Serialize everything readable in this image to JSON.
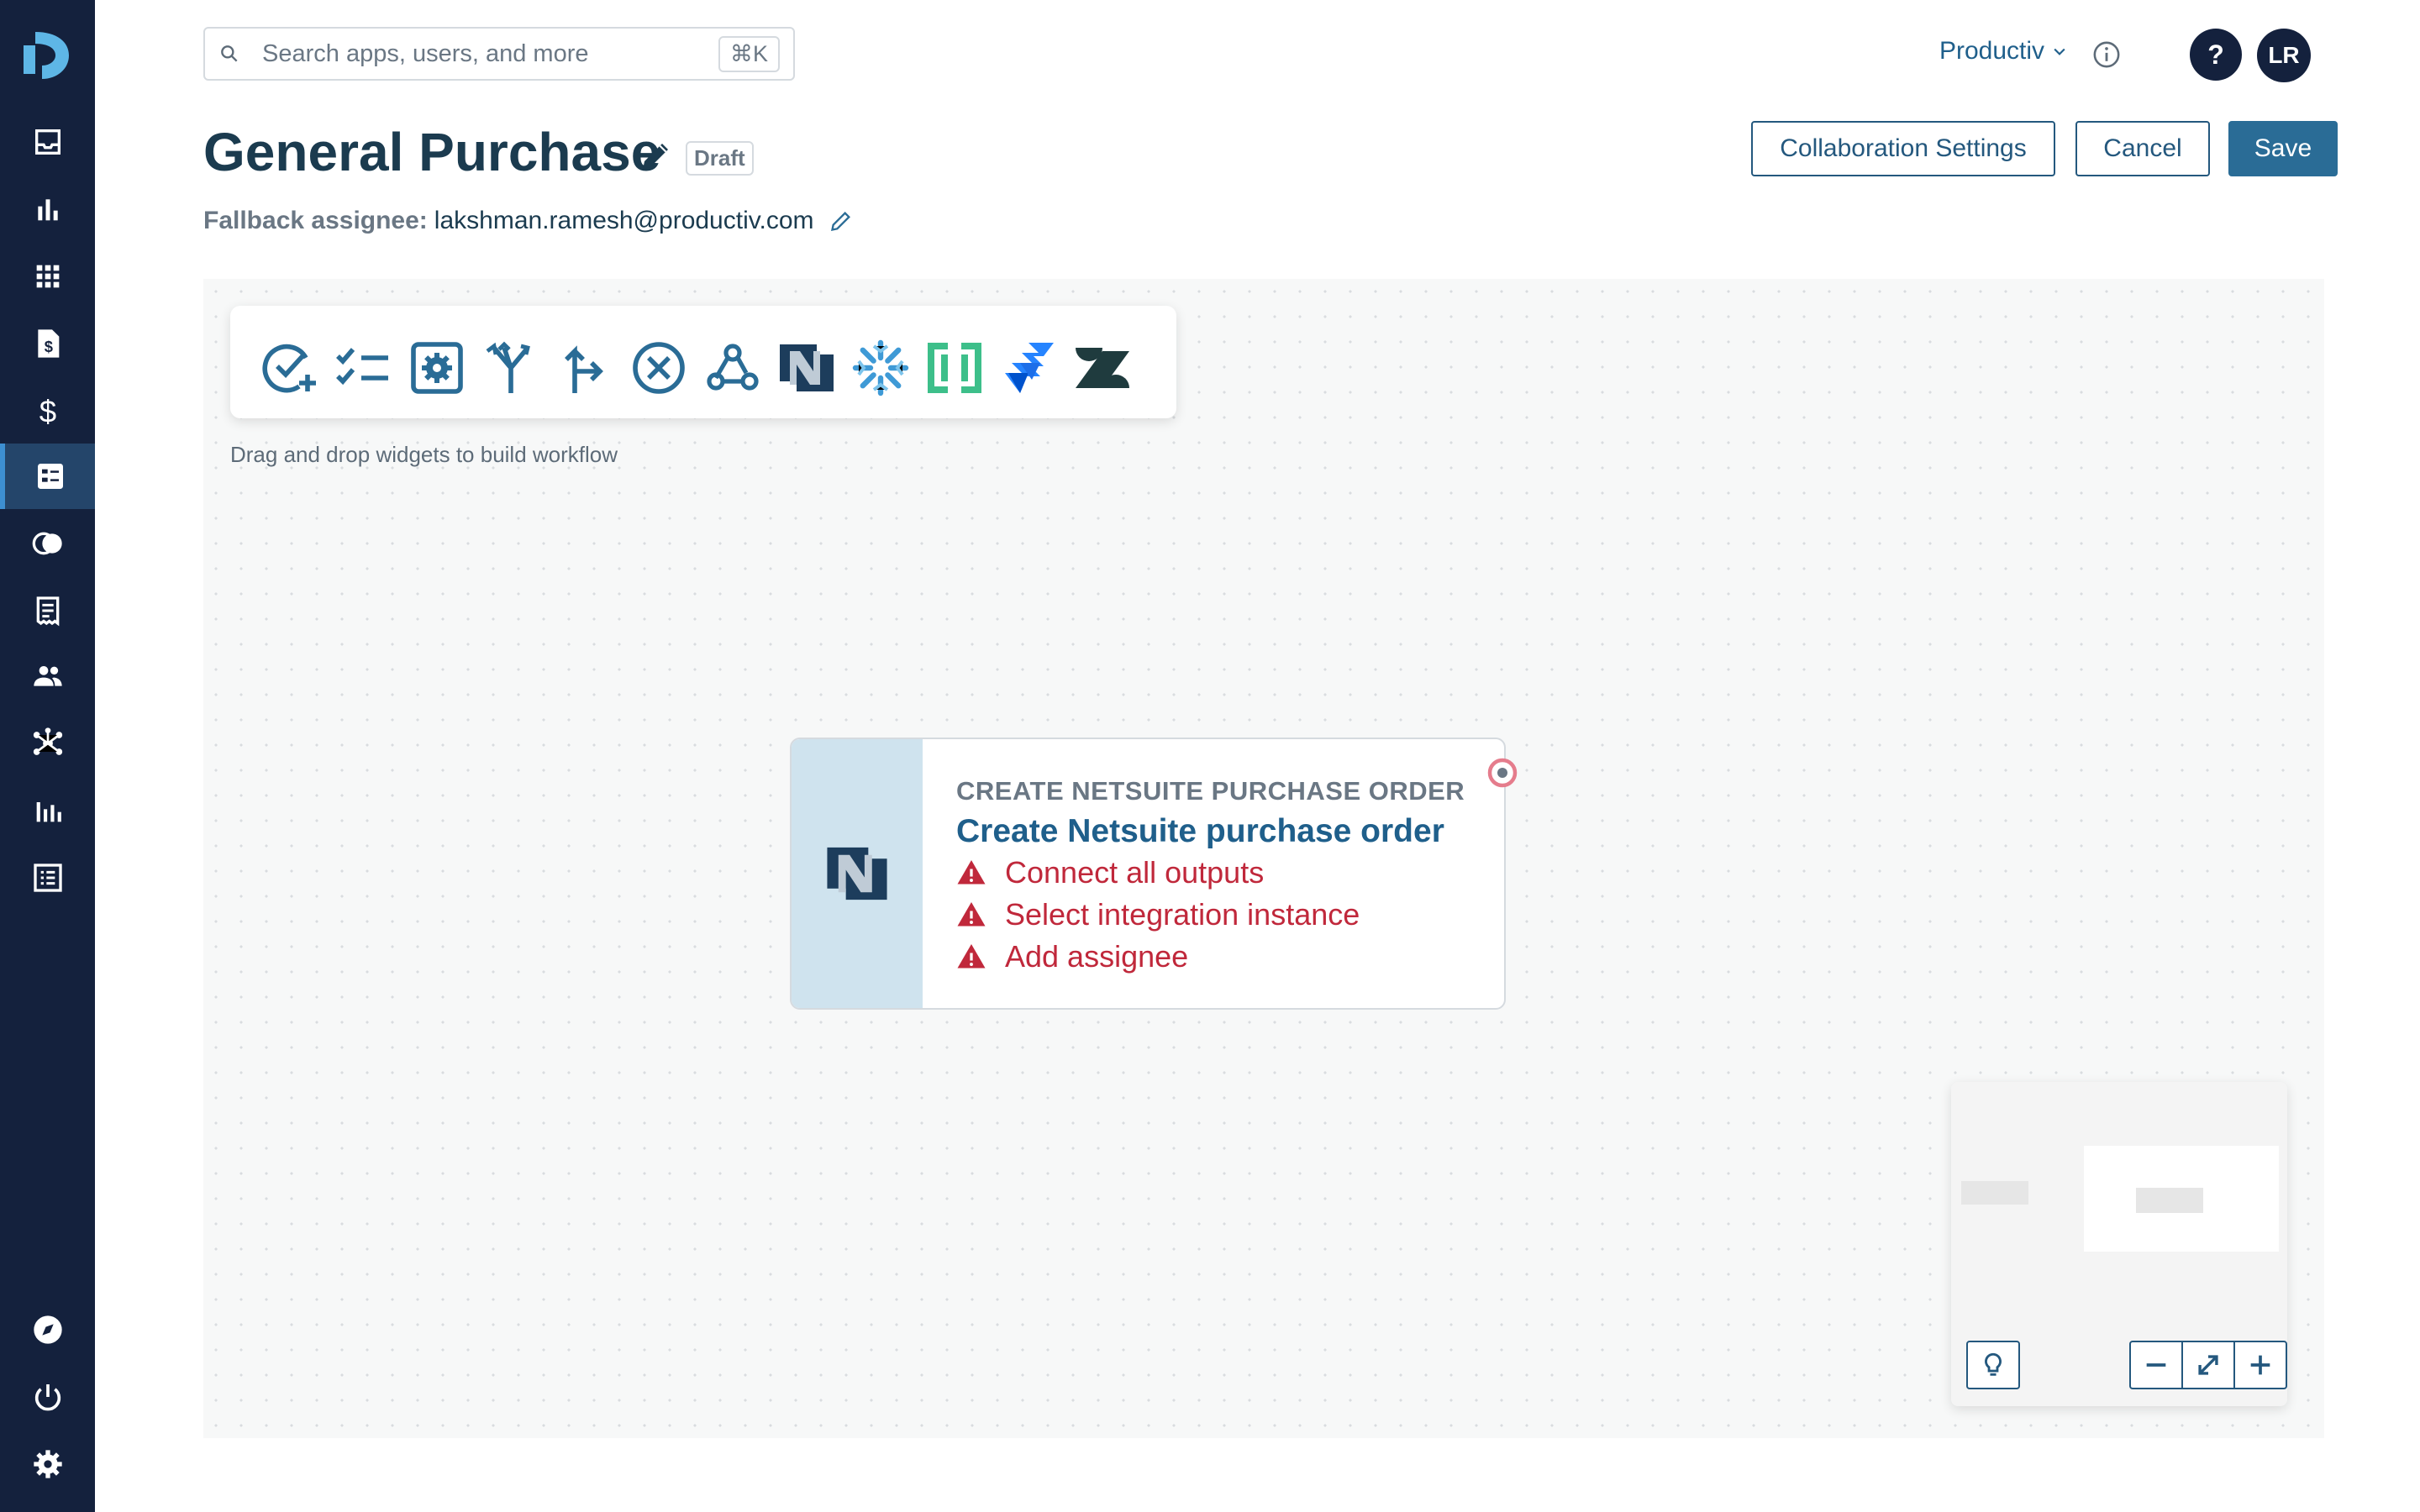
{
  "search": {
    "placeholder": "Search apps, users, and more",
    "shortcut": "⌘K"
  },
  "header": {
    "org_name": "Productiv",
    "help_label": "?",
    "avatar_initials": "LR"
  },
  "page": {
    "title": "General Purchase",
    "status_badge": "Draft",
    "fallback_label": "Fallback assignee:",
    "fallback_value": "lakshman.ramesh@productiv.com"
  },
  "actions": {
    "collab_label": "Collaboration Settings",
    "cancel_label": "Cancel",
    "save_label": "Save"
  },
  "palette": {
    "hint": "Drag and drop widgets to build workflow",
    "widgets": [
      "approval-icon",
      "checklist-icon",
      "settings-box-icon",
      "branch-icon",
      "route-icon",
      "end-icon",
      "webhook-icon",
      "netsuite-icon",
      "snowflake-icon",
      "coupa-icon",
      "jira-icon",
      "zendesk-icon"
    ]
  },
  "node": {
    "kicker": "CREATE NETSUITE PURCHASE ORDER",
    "title": "Create Netsuite purchase order",
    "warnings": [
      "Connect all outputs",
      "Select integration instance",
      "Add assignee"
    ]
  },
  "colors": {
    "sidebar_bg": "#14213d",
    "accent": "#2a6c96",
    "error": "#c0283b",
    "node_side": "#cfe3ee"
  }
}
